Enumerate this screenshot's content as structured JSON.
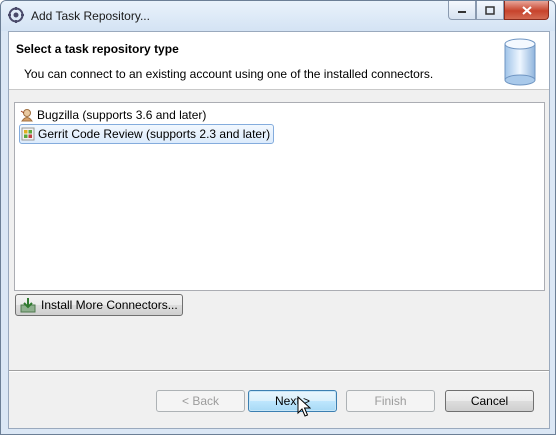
{
  "window": {
    "title": "Add Task Repository...",
    "icon": "eclipse-app-icon"
  },
  "caption_buttons": {
    "minimize": "minimize-icon",
    "maximize": "maximize-icon",
    "close": "close-icon"
  },
  "header": {
    "title": "Select a task repository type",
    "description": "You can connect to an existing account using one of the installed connectors.",
    "image": "repository-cylinder-icon"
  },
  "connectors": [
    {
      "label": "Bugzilla (supports 3.6 and later)",
      "icon": "bugzilla-icon",
      "selected": false
    },
    {
      "label": "Gerrit Code Review (supports 2.3 and later)",
      "icon": "gerrit-icon",
      "selected": true
    }
  ],
  "install_button": {
    "label": "Install More Connectors...",
    "icon": "install-icon"
  },
  "buttons": {
    "back": "< Back",
    "next": "Next >",
    "finish": "Finish",
    "cancel": "Cancel"
  },
  "colors": {
    "selection_border": "#84acdd",
    "default_button_border": "#3c7fb1"
  }
}
